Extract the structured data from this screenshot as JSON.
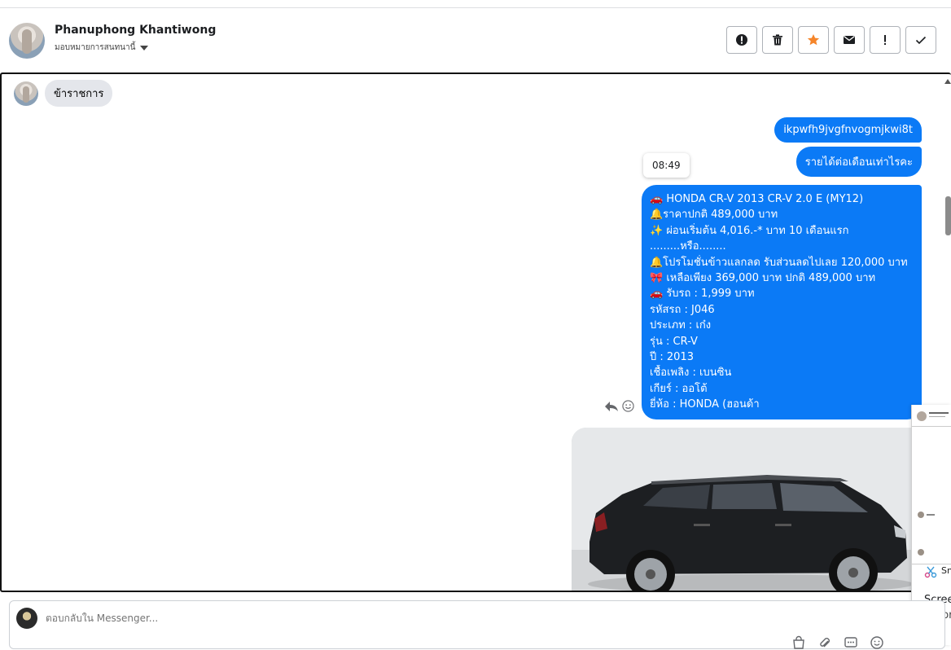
{
  "header": {
    "name": "Phanuphong Khantiwong",
    "assign_label": "มอบหมายการสนทนานี้"
  },
  "chat": {
    "tag_label": "ข้าราชการ",
    "messages": [
      "ikpwfh9jvgfnvogmjkwi8t",
      "รายได้ต่อเดือนเท่าไรคะ"
    ],
    "timestamp": "08:49",
    "listing_lines": [
      "🚗 HONDA CR-V 2013 CR-V 2.0 E (MY12)",
      "🔔ราคาปกติ 489,000 บาท",
      "✨ ผ่อนเริ่มต้น 4,016.-* บาท 10 เดือนแรก",
      ".........หรือ........",
      "🔔โปรโมชั่นข้าวแลกลด รับส่วนลดไปเลย 120,000 บาท",
      "🎀 เหลือเพียง 369,000 บาท ปกติ 489,000 บาท",
      "🚗 รับรถ : 1,999 บาท",
      " รหัสรถ : J046",
      " ประเภท : เก๋ง",
      " รุ่น : CR-V",
      " ปี : 2013",
      " เชื้อเพลิง : เบนซิน",
      " เกียร์ : ออโต้",
      " ยี่ห้อ : HONDA (ฮอนด้า"
    ]
  },
  "composer": {
    "placeholder": "ตอบกลับใน Messenger..."
  },
  "side_panel": {
    "snip_label": "Sn",
    "text1": "Scree",
    "text2": "Autor"
  },
  "colors": {
    "bubble": "#0b7af6",
    "star": "#f5852a"
  }
}
